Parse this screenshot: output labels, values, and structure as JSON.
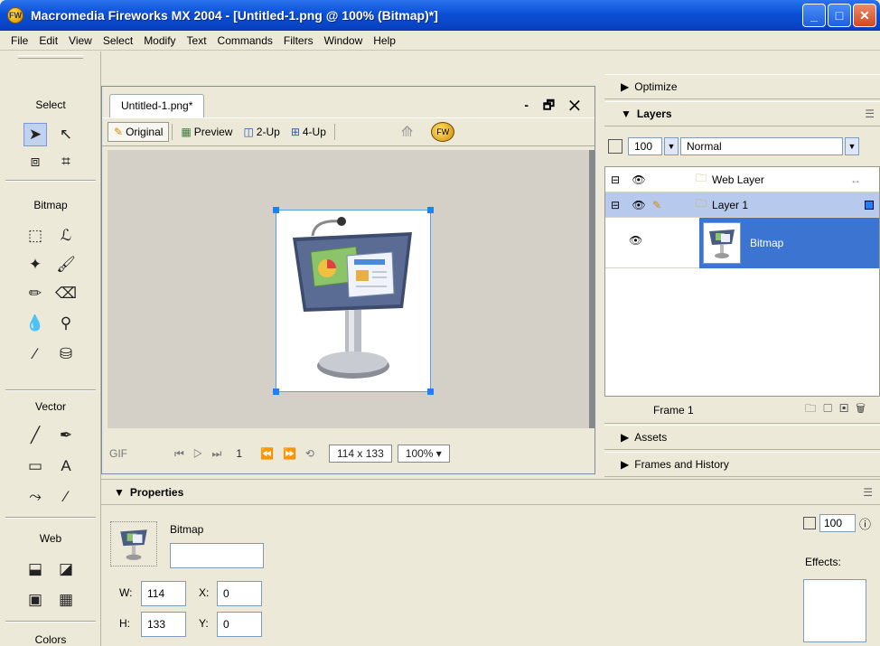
{
  "window": {
    "title": "Macromedia Fireworks MX 2004 - [Untitled-1.png @ 100% (Bitmap)*]"
  },
  "menu": [
    "File",
    "Edit",
    "View",
    "Select",
    "Modify",
    "Text",
    "Commands",
    "Filters",
    "Window",
    "Help"
  ],
  "tools": {
    "sections": {
      "select": "Select",
      "bitmap": "Bitmap",
      "vector": "Vector",
      "web": "Web",
      "colors": "Colors"
    }
  },
  "document": {
    "tab_label": "Untitled-1.png*",
    "views": {
      "original": "Original",
      "preview": "Preview",
      "two_up": "2-Up",
      "four_up": "4-Up"
    },
    "status": {
      "format": "GIF",
      "frame": "1",
      "size": "114 x 133",
      "zoom": "100%"
    }
  },
  "panels": {
    "optimize": "Optimize",
    "layers": {
      "title": "Layers",
      "opacity": "100",
      "blend_mode": "Normal",
      "rows": [
        {
          "name": "Web Layer"
        },
        {
          "name": "Layer 1"
        }
      ],
      "object": "Bitmap",
      "frame_label": "Frame 1"
    },
    "assets": "Assets",
    "frames_history": "Frames and History"
  },
  "properties": {
    "title": "Properties",
    "object_type": "Bitmap",
    "name_value": "",
    "w_label": "W:",
    "w_value": "114",
    "h_label": "H:",
    "h_value": "133",
    "x_label": "X:",
    "x_value": "0",
    "y_label": "Y:",
    "y_value": "0",
    "opacity_value": "100",
    "effects_label": "Effects:"
  }
}
